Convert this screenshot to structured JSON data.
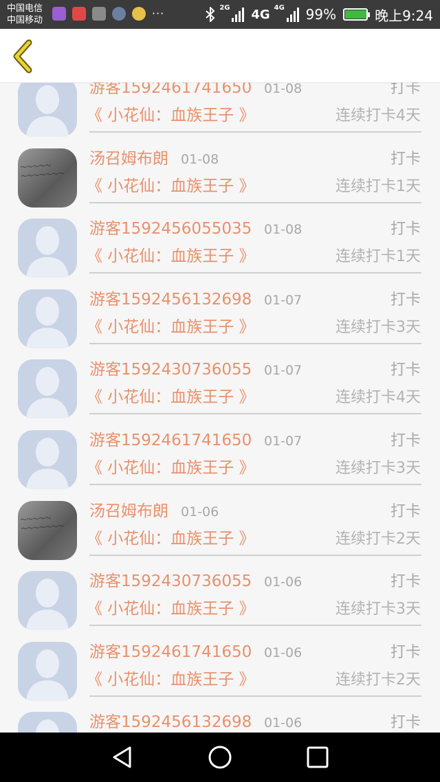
{
  "status_bar": {
    "carrier_1": "中国电信",
    "carrier_2": "中国移动",
    "more": "···",
    "net_2g": "2G",
    "net_4g_a": "4G",
    "net_4g_b": "4G",
    "battery": "99%",
    "time": "晚上9:24"
  },
  "header": {
    "back_icon": "chevron-left-icon"
  },
  "colors": {
    "accent": "#e8916c",
    "muted": "#a8a8a8",
    "avatar_default": "#c9d3e6",
    "back_icon": "#e8d432"
  },
  "records": [
    {
      "name": "游客1592461741650",
      "date": "01-08",
      "action": "打卡",
      "book": "《 小花仙：血族王子 》",
      "streak": "连续打卡4天",
      "avatar": "default"
    },
    {
      "name": "汤召姆布朗",
      "date": "01-08",
      "action": "打卡",
      "book": "《 小花仙：血族王子 》",
      "streak": "连续打卡1天",
      "avatar": "photo"
    },
    {
      "name": "游客1592456055035",
      "date": "01-08",
      "action": "打卡",
      "book": "《 小花仙：血族王子 》",
      "streak": "连续打卡1天",
      "avatar": "default"
    },
    {
      "name": "游客1592456132698",
      "date": "01-07",
      "action": "打卡",
      "book": "《 小花仙：血族王子 》",
      "streak": "连续打卡3天",
      "avatar": "default"
    },
    {
      "name": "游客1592430736055",
      "date": "01-07",
      "action": "打卡",
      "book": "《 小花仙：血族王子 》",
      "streak": "连续打卡4天",
      "avatar": "default"
    },
    {
      "name": "游客1592461741650",
      "date": "01-07",
      "action": "打卡",
      "book": "《 小花仙：血族王子 》",
      "streak": "连续打卡3天",
      "avatar": "default"
    },
    {
      "name": "汤召姆布朗",
      "date": "01-06",
      "action": "打卡",
      "book": "《 小花仙：血族王子 》",
      "streak": "连续打卡2天",
      "avatar": "photo"
    },
    {
      "name": "游客1592430736055",
      "date": "01-06",
      "action": "打卡",
      "book": "《 小花仙：血族王子 》",
      "streak": "连续打卡3天",
      "avatar": "default"
    },
    {
      "name": "游客1592461741650",
      "date": "01-06",
      "action": "打卡",
      "book": "《 小花仙：血族王子 》",
      "streak": "连续打卡2天",
      "avatar": "default"
    },
    {
      "name": "游客1592456132698",
      "date": "01-06",
      "action": "打卡",
      "book": "",
      "streak": "",
      "avatar": "default"
    }
  ],
  "nav_bar": {
    "back": "triangle-back-icon",
    "home": "circle-home-icon",
    "recents": "square-recents-icon"
  }
}
